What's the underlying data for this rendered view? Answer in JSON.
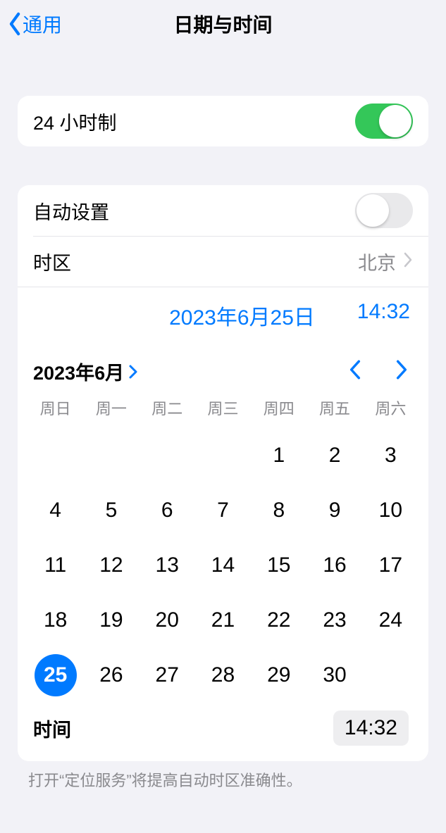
{
  "nav": {
    "back_label": "通用",
    "title": "日期与时间"
  },
  "rows": {
    "hour24": "24 小时制",
    "auto_set": "自动设置",
    "timezone_label": "时区",
    "timezone_value": "北京"
  },
  "datetime": {
    "date": "2023年6月25日",
    "time": "14:32"
  },
  "calendar": {
    "month_label": "2023年6月",
    "weekdays": [
      "周日",
      "周一",
      "周二",
      "周三",
      "周四",
      "周五",
      "周六"
    ],
    "leading_blanks": 4,
    "days": [
      1,
      2,
      3,
      4,
      5,
      6,
      7,
      8,
      9,
      10,
      11,
      12,
      13,
      14,
      15,
      16,
      17,
      18,
      19,
      20,
      21,
      22,
      23,
      24,
      25,
      26,
      27,
      28,
      29,
      30
    ],
    "selected": 25
  },
  "time_row": {
    "label": "时间",
    "value": "14:32"
  },
  "footer": "打开“定位服务”将提高自动时区准确性。"
}
